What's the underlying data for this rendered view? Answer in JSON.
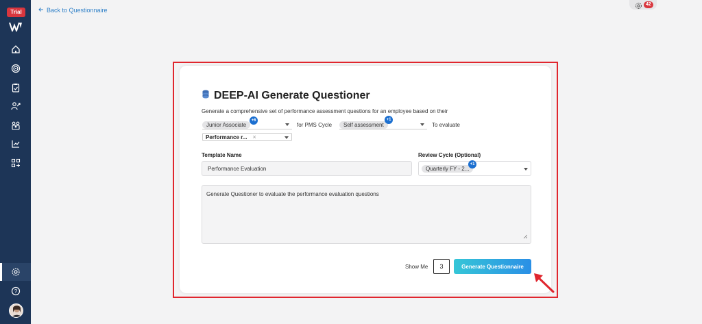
{
  "sidebar": {
    "trial_label": "Trial",
    "items": [
      {
        "icon": "home-icon"
      },
      {
        "icon": "target-icon"
      },
      {
        "icon": "clipboard-icon"
      },
      {
        "icon": "user-growth-icon"
      },
      {
        "icon": "team-icon"
      },
      {
        "icon": "chart-icon"
      },
      {
        "icon": "apps-icon"
      },
      {
        "icon": "gear-icon",
        "active": true
      },
      {
        "icon": "help-icon"
      }
    ]
  },
  "header": {
    "back_label": "Back to Questionnaire",
    "notification_count": "42"
  },
  "form": {
    "title": "DEEP-AI Generate Questioner",
    "subtitle": "Generate a comprehensive set of performance assessment questions for an employee based on their",
    "role_chip": "Junior Associate",
    "role_more": "+6",
    "for_pms_cycle": "for PMS Cycle",
    "cycle_chip": "Self assessment",
    "cycle_more": "+1",
    "to_evaluate": "To evaluate",
    "evaluate_chip": "Performance r...",
    "template_name_label": "Template Name",
    "template_name_value": "Performance Evaluation",
    "review_cycle_label": "Review Cycle (Optional)",
    "review_cycle_chip": "Quarterly FY - 2...",
    "review_cycle_more": "+1",
    "prompt_text": "Generate Questioner to evaluate the performance evaluation questions",
    "show_me_label": "Show Me",
    "show_me_value": "3",
    "generate_button": "Generate Questionnaire"
  },
  "colors": {
    "sidebar_bg": "#1d3557",
    "accent": "#2a8fe6",
    "highlight": "#e0262e"
  }
}
